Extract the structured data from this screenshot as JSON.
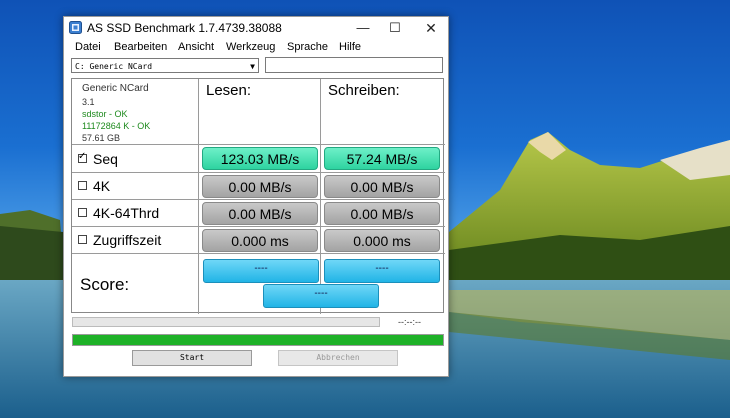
{
  "window": {
    "title": "AS SSD Benchmark 1.7.4739.38088",
    "controls": {
      "minimize": "—",
      "maximize": "☐",
      "close": "✕"
    }
  },
  "menu": [
    "Datei",
    "Bearbeiten",
    "Ansicht",
    "Werkzeug",
    "Sprache",
    "Hilfe"
  ],
  "drive_select": {
    "value": "C: Generic NCard",
    "arrow_icon": "chevron-down-icon"
  },
  "path_field": {
    "value": ""
  },
  "drive_info": {
    "name": "Generic NCard",
    "version": "3.1",
    "driver_status": "sdstor - OK",
    "alignment_status": "11172864 K - OK",
    "capacity": "57.61 GB"
  },
  "columns": {
    "read": "Lesen:",
    "write": "Schreiben:"
  },
  "rows": [
    {
      "label": "Seq",
      "checked": true,
      "read": "123.03 MB/s",
      "write": "57.24 MB/s"
    },
    {
      "label": "4K",
      "checked": false,
      "read": "0.00 MB/s",
      "write": "0.00 MB/s"
    },
    {
      "label": "4K-64Thrd",
      "checked": false,
      "read": "0.00 MB/s",
      "write": "0.00 MB/s"
    },
    {
      "label": "Zugriffszeit",
      "checked": false,
      "read": "0.000 ms",
      "write": "0.000 ms"
    }
  ],
  "score": {
    "label": "Score:",
    "read": "----",
    "write": "----",
    "total": "----"
  },
  "progress": {
    "timer": "--:--:--",
    "main_progress_fraction": 1.0,
    "sub_progress_fraction": 0.0
  },
  "buttons": {
    "start": "Start",
    "abort": "Abbrechen"
  },
  "colors": {
    "result_fast": "#2ed3a0",
    "score_blue": "#21b4e6",
    "progress_green": "#1eb127"
  }
}
